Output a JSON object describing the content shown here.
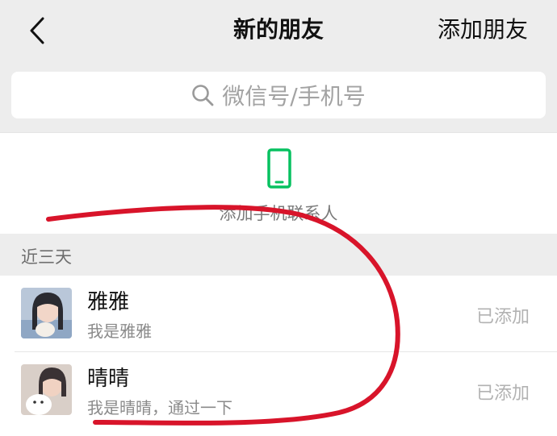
{
  "navbar": {
    "back_icon": "chevron-left-icon",
    "title": "新的朋友",
    "action_label": "添加朋友"
  },
  "search": {
    "icon": "search-icon",
    "placeholder": "微信号/手机号"
  },
  "phone_contacts": {
    "icon": "phone-icon",
    "icon_color": "#07c160",
    "label": "添加手机联系人"
  },
  "section": {
    "title": "近三天"
  },
  "friends": [
    {
      "name": "雅雅",
      "message": "我是雅雅",
      "status": "已添加"
    },
    {
      "name": "晴晴",
      "message": "我是晴晴，通过一下",
      "status": "已添加"
    }
  ],
  "annotation": {
    "color": "#d8142a"
  }
}
